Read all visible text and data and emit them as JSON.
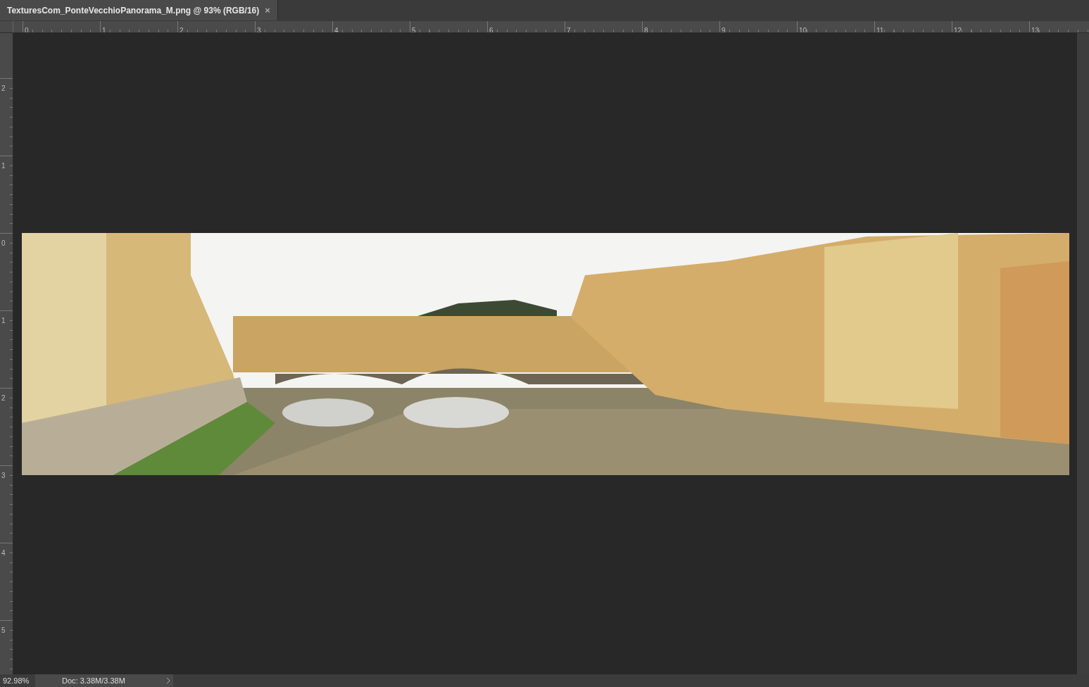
{
  "document_tab": {
    "title": "TexturesCom_PonteVecchioPanorama_M.png @ 93% (RGB/16)",
    "close": "×",
    "selected": true
  },
  "rulers": {
    "horizontal": [
      "0",
      "1",
      "2",
      "3",
      "4",
      "5",
      "6",
      "7",
      "8",
      "9",
      "10",
      "11",
      "12",
      "13"
    ],
    "vertical": [
      "2",
      "1",
      "0",
      "1",
      "2",
      "3",
      "4",
      "5"
    ]
  },
  "status_bar": {
    "zoom": "92.98%",
    "doc_info": "Doc: 3.38M/3.38M"
  }
}
